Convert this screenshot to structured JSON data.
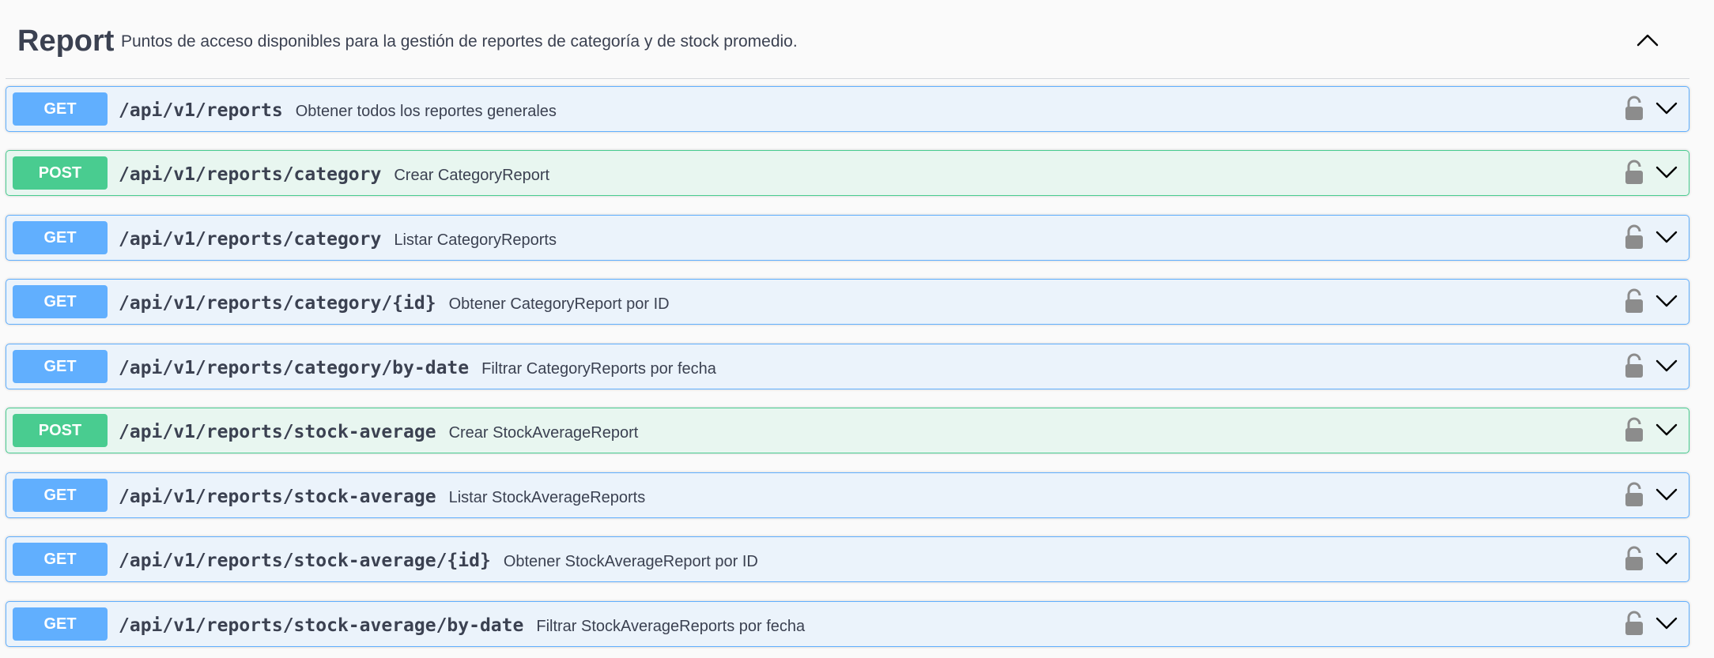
{
  "tag": {
    "name": "Report",
    "description": "Puntos de acceso disponibles para la gestión de reportes de categoría y de stock promedio."
  },
  "colors": {
    "get": "#61affe",
    "post": "#49cc90",
    "text": "#3b4151"
  },
  "operations": [
    {
      "method": "GET",
      "path": "/api/v1/reports",
      "summary": "Obtener todos los reportes generales"
    },
    {
      "method": "POST",
      "path": "/api/v1/reports/category",
      "summary": "Crear CategoryReport"
    },
    {
      "method": "GET",
      "path": "/api/v1/reports/category",
      "summary": "Listar CategoryReports"
    },
    {
      "method": "GET",
      "path": "/api/v1/reports/category/{id}",
      "summary": "Obtener CategoryReport por ID"
    },
    {
      "method": "GET",
      "path": "/api/v1/reports/category/by-date",
      "summary": "Filtrar CategoryReports por fecha"
    },
    {
      "method": "POST",
      "path": "/api/v1/reports/stock-average",
      "summary": "Crear StockAverageReport"
    },
    {
      "method": "GET",
      "path": "/api/v1/reports/stock-average",
      "summary": "Listar StockAverageReports"
    },
    {
      "method": "GET",
      "path": "/api/v1/reports/stock-average/{id}",
      "summary": "Obtener StockAverageReport por ID"
    },
    {
      "method": "GET",
      "path": "/api/v1/reports/stock-average/by-date",
      "summary": "Filtrar StockAverageReports por fecha"
    }
  ],
  "icons": {
    "collapse": "chevron-up-icon",
    "lock": "unlocked-padlock-icon",
    "expand": "chevron-down-icon"
  }
}
